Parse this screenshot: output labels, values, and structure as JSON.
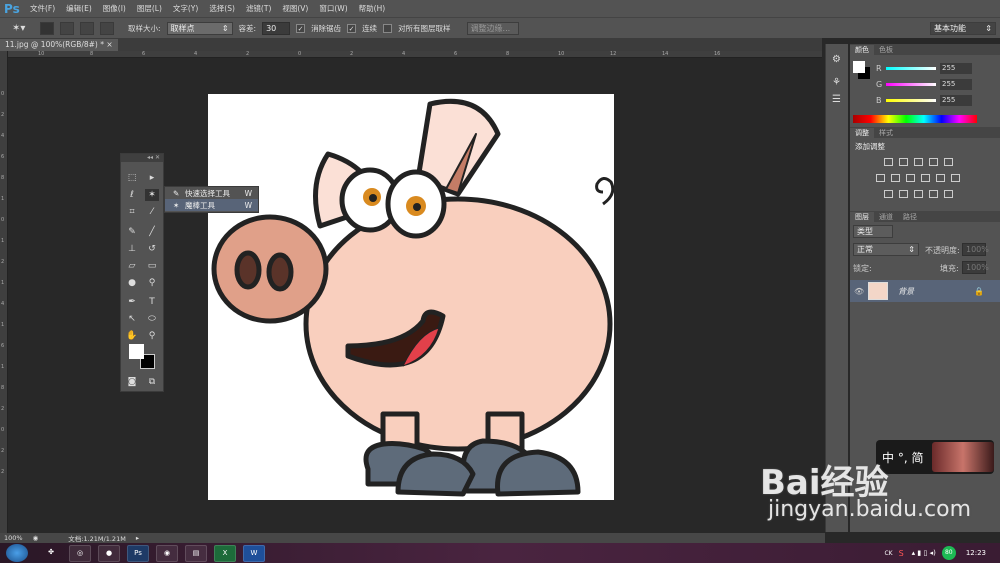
{
  "app": {
    "logo": "Ps"
  },
  "menu": [
    "文件(F)",
    "编辑(E)",
    "图像(I)",
    "图层(L)",
    "文字(Y)",
    "选择(S)",
    "滤镜(T)",
    "视图(V)",
    "窗口(W)",
    "帮助(H)"
  ],
  "options": {
    "sample_size_label": "取样大小:",
    "sample_size_value": "取样点",
    "tolerance_label": "容差:",
    "tolerance_value": "30",
    "antialias": "消除锯齿",
    "contiguous": "连续",
    "all_layers": "对所有图层取样",
    "refine_edge": "调整边缘...",
    "workspace": "基本功能"
  },
  "document": {
    "tab": "11.jpg @ 100%(RGB/8#) *",
    "close": "×"
  },
  "ruler_top": [
    "10",
    "8",
    "6",
    "4",
    "2",
    "0",
    "2",
    "4",
    "6",
    "8",
    "10",
    "12",
    "14",
    "16"
  ],
  "ruler_left": [
    "0",
    "2",
    "4",
    "6",
    "8",
    "1",
    "0",
    "1",
    "2",
    "1",
    "4",
    "1",
    "6",
    "1",
    "8",
    "2",
    "0",
    "2",
    "2"
  ],
  "flyout": [
    {
      "label": "快速选择工具",
      "key": "W",
      "active": false
    },
    {
      "label": "魔棒工具",
      "key": "W",
      "active": true
    }
  ],
  "color_panel": {
    "tabs": [
      "颜色",
      "色板"
    ],
    "r_label": "R",
    "g_label": "G",
    "b_label": "B",
    "r": "255",
    "g": "255",
    "b": "255"
  },
  "adjust_panel": {
    "tabs": [
      "调整",
      "样式"
    ],
    "title": "添加调整"
  },
  "layers_panel": {
    "tabs": [
      "图层",
      "通道",
      "路径"
    ],
    "filter": "类型",
    "blend": "正常",
    "opacity_label": "不透明度:",
    "opacity": "100%",
    "lock_label": "锁定:",
    "fill_label": "填充:",
    "fill": "100%",
    "layer_name": "背景"
  },
  "status": {
    "zoom": "100%",
    "doc": "文档:1.21M/1.21M"
  },
  "ime": {
    "text": "中 °, 简"
  },
  "watermark": {
    "brand": "Bai经验",
    "url": "jingyan.baidu.com"
  },
  "taskbar": {
    "apps": [
      "chrome",
      "wechat",
      "photoshop",
      "firefox",
      "explorer",
      "excel",
      "word"
    ],
    "tray_lang": "CK",
    "battery": "80",
    "time": "12:23"
  }
}
